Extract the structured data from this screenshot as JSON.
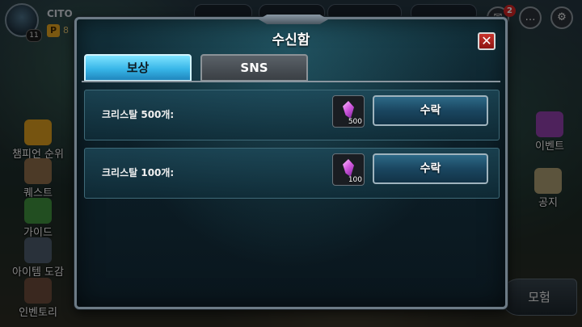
{
  "player": {
    "name": "CITO",
    "level": "11",
    "currency_badge": "P",
    "currency_value": "8"
  },
  "notifications": {
    "count": "2"
  },
  "left_menu": [
    {
      "label": "챔피언 순위",
      "icon": "champion-p-icon"
    },
    {
      "label": "퀘스트",
      "icon": "scroll-icon"
    },
    {
      "label": "가이드",
      "icon": "question-icon"
    },
    {
      "label": "아이템 도감",
      "icon": "item-book-icon"
    },
    {
      "label": "인벤토리",
      "icon": "bag-icon"
    }
  ],
  "right_menu": [
    {
      "label": "이벤트",
      "icon": "crystal-icon"
    },
    {
      "label": "공지",
      "icon": "notice-icon"
    }
  ],
  "adventure_label": "모험",
  "dialog": {
    "title": "수신함",
    "close_icon": "✕",
    "tabs": [
      {
        "label": "보상",
        "active": true
      },
      {
        "label": "SNS",
        "active": false
      }
    ],
    "items": [
      {
        "label": "크리스탈 500개:",
        "quantity": "500",
        "button_label": "수락",
        "icon": "crystal-icon"
      },
      {
        "label": "크리스탈 100개:",
        "quantity": "100",
        "button_label": "수락",
        "icon": "crystal-icon"
      }
    ]
  },
  "colors": {
    "tab_active": "#38b6e8",
    "close_button": "#c8332c",
    "crystal": "#d35be0"
  }
}
